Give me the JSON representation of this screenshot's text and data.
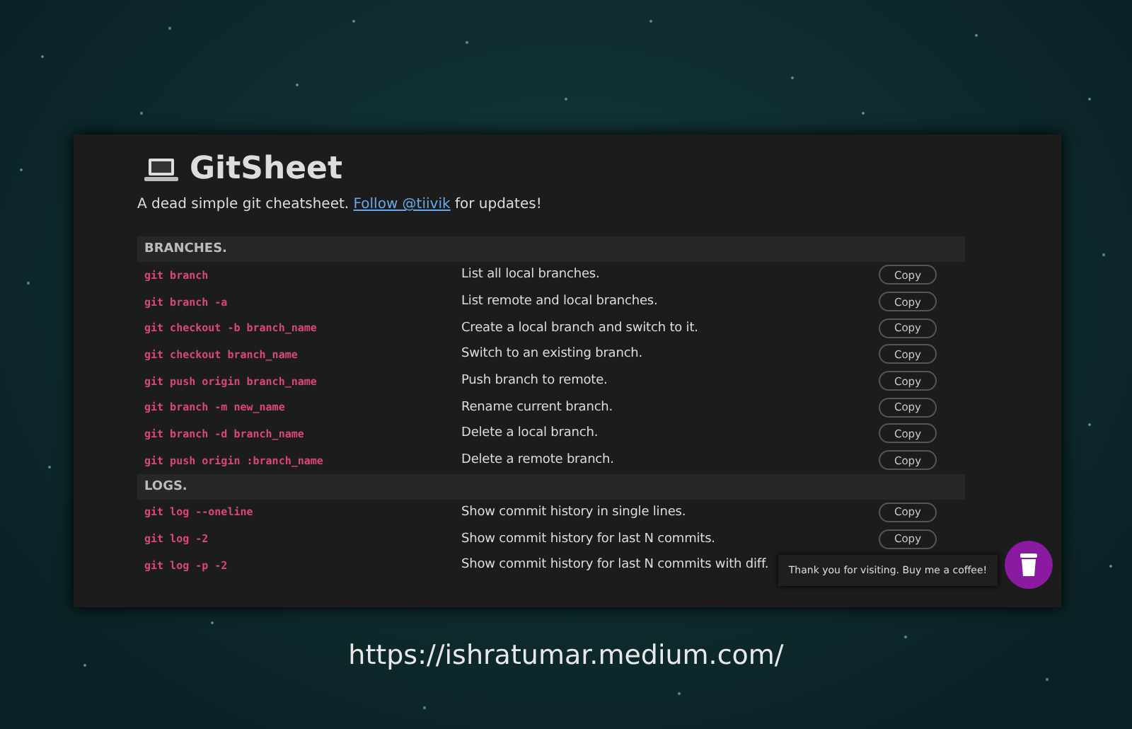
{
  "header": {
    "title": "GitSheet",
    "subtitle_before": "A dead simple git cheatsheet.",
    "link": "Follow @tiivik",
    "subtitle_after": "for updates!"
  },
  "sections": [
    {
      "title": "BRANCHES.",
      "rows": [
        {
          "command": "git branch",
          "description": "List all local branches.",
          "button": "Copy"
        },
        {
          "command": "git branch -a",
          "description": "List remote and local branches.",
          "button": "Copy"
        },
        {
          "command": "git checkout -b branch_name",
          "description": "Create a local branch and switch to it.",
          "button": "Copy"
        },
        {
          "command": "git checkout branch_name",
          "description": "Switch to an existing branch.",
          "button": "Copy"
        },
        {
          "command": "git push origin branch_name",
          "description": "Push branch to remote.",
          "button": "Copy"
        },
        {
          "command": "git branch -m new_name",
          "description": "Rename current branch.",
          "button": "Copy"
        },
        {
          "command": "git branch -d branch_name",
          "description": "Delete a local branch.",
          "button": "Copy"
        },
        {
          "command": "git push origin :branch_name",
          "description": "Delete a remote branch.",
          "button": "Copy"
        }
      ]
    },
    {
      "title": "LOGS.",
      "rows": [
        {
          "command": "git log --oneline",
          "description": "Show commit history in single lines.",
          "button": "Copy"
        },
        {
          "command": "git log -2",
          "description": "Show commit history for last N commits.",
          "button": "Copy"
        },
        {
          "command": "git log -p -2",
          "description": "Show commit history for last N commits with diff."
        }
      ]
    }
  ],
  "tooltip": "Thank you for visiting. Buy me a coffee!",
  "caption": "https://ishratumar.medium.com/"
}
